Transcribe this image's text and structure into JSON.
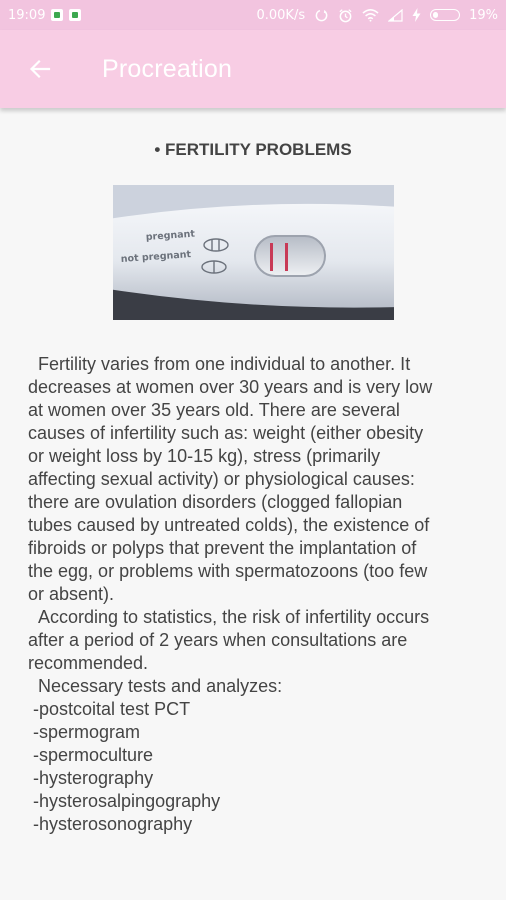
{
  "status_bar": {
    "time": "19:09",
    "network_speed": "0.00K/s",
    "battery_percent": "19%",
    "icons": [
      "notification-icon",
      "notification-icon",
      "sync-icon",
      "alarm-icon",
      "wifi-icon",
      "signal-icon",
      "charging-icon",
      "battery-icon"
    ]
  },
  "app_bar": {
    "title": "Procreation",
    "back_icon": "arrow-left-icon"
  },
  "article": {
    "heading": "• FERTILITY PROBLEMS",
    "image_labels": {
      "pregnant": "pregnant",
      "not_pregnant": "not pregnant"
    },
    "body": "  Fertility varies from one individual to another. It\ndecreases at women over 30 years and is very low\nat women over 35 years old. There are several\ncauses of infertility such as: weight (either obesity\nor weight loss by 10-15 kg), stress (primarily\naffecting sexual activity) or physiological causes:\nthere are ovulation disorders (clogged fallopian\ntubes caused by untreated colds), the existence of\nfibroids or polyps that prevent the implantation of\nthe egg, or problems with spermatozoons (too few\nor absent).\n  According to statistics, the risk of infertility occurs\nafter a period of 2 years when consultations are\nrecommended.\n  Necessary tests and analyzes:\n -postcoital test PCT\n -spermogram\n -spermoculture\n -hysterography\n -hysterosalpingography\n -hysterosonography"
  },
  "colors": {
    "status_bar": "#f2c4df",
    "app_bar": "#f8cde4",
    "background": "#f7f7f7",
    "text": "#444444"
  }
}
